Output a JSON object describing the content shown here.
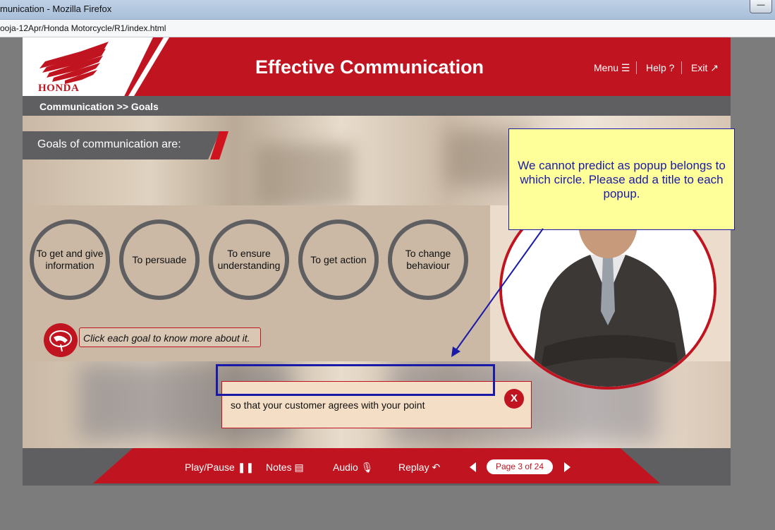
{
  "browser": {
    "window_title": "munication - Mozilla Firefox",
    "url": "ooja-12Apr/Honda Motorcycle/R1/index.html",
    "minimize_label": "—"
  },
  "header": {
    "brand": "HONDA",
    "title": "Effective Communication",
    "nav": {
      "menu": "Menu ☰",
      "help": "Help ?",
      "exit": "Exit ↗"
    }
  },
  "breadcrumb": "Communication >> Goals",
  "goals": {
    "heading": "Goals of communication are:",
    "items": [
      "To get and give information",
      "To persuade",
      "To ensure understanding",
      "To get action",
      "To change behaviour"
    ],
    "instruction": "Click each goal to know more about it."
  },
  "popup": {
    "text": "so that your customer agrees with your point",
    "close_label": "X"
  },
  "footer": {
    "play_pause": "Play/Pause ❚❚",
    "notes": "Notes ▤",
    "audio": "Audio 🎙",
    "replay": "Replay ↶",
    "page": "Page 3 of 24"
  },
  "review_note": {
    "text": "We cannot predict as popup belongs to which circle. Please add a title to each popup."
  },
  "colors": {
    "brand_red": "#c01520",
    "dark_gray": "#5f5f62",
    "note_yellow": "#ffff99",
    "note_blue": "#1a1aa8"
  }
}
